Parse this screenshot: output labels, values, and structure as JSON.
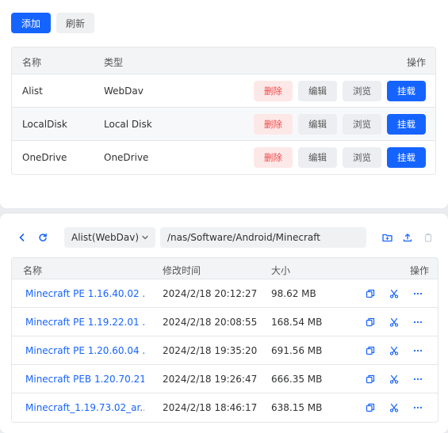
{
  "toolbar": {
    "add_label": "添加",
    "refresh_label": "刷新"
  },
  "storage_table": {
    "columns": {
      "name": "名称",
      "type": "类型",
      "actions": "操作"
    },
    "action_labels": {
      "delete": "删除",
      "edit": "编辑",
      "browse": "浏览",
      "mount": "挂载"
    },
    "rows": [
      {
        "name": "Alist",
        "type": "WebDav"
      },
      {
        "name": "LocalDisk",
        "type": "Local Disk"
      },
      {
        "name": "OneDrive",
        "type": "OneDrive"
      }
    ]
  },
  "browser": {
    "icons": [
      "back-icon",
      "reload-icon",
      "chevron-down-icon",
      "new-folder-icon",
      "upload-icon",
      "paste-icon"
    ],
    "datasource_selected": "Alist(WebDav)",
    "path_value": "/nas/Software/Android/Minecraft",
    "columns": {
      "name": "名称",
      "modified": "修改时间",
      "size": "大小",
      "actions": "操作"
    },
    "files": [
      {
        "name": "Minecraft PE 1.16.40.02 ...",
        "modified": "2024/2/18 20:12:27",
        "size": "98.62 MB"
      },
      {
        "name": "Minecraft PE 1.19.22.01 ...",
        "modified": "2024/2/18 20:08:55",
        "size": "168.54 MB"
      },
      {
        "name": "Minecraft PE 1.20.60.04 ...",
        "modified": "2024/2/18 19:35:20",
        "size": "691.56 MB"
      },
      {
        "name": "Minecraft PEB 1.20.70.21...",
        "modified": "2024/2/18 19:26:47",
        "size": "666.35 MB"
      },
      {
        "name": "Minecraft_1.19.73.02_ar...",
        "modified": "2024/2/18 18:46:17",
        "size": "638.15 MB"
      }
    ],
    "row_icons": [
      "copy-icon",
      "cut-icon",
      "more-icon"
    ]
  },
  "colors": {
    "primary": "#1664ff",
    "danger": "#f04848",
    "danger_bg": "#fde8e8",
    "page_bg": "#e9ebef"
  }
}
